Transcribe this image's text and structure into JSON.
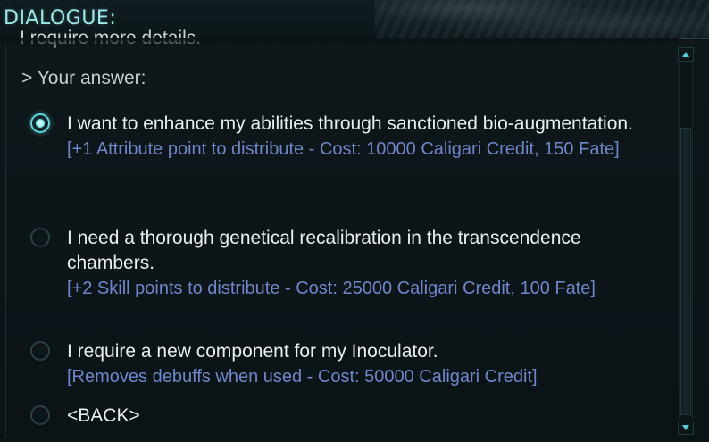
{
  "header": {
    "title": "DIALOGUE:"
  },
  "dialogue": {
    "previous_line": "I require more details.",
    "prompt": "> Your answer:",
    "options": [
      {
        "text": "I want to enhance my abilities through sanctioned bio-augmentation.",
        "detail": "[+1 Attribute point to distribute - Cost: 10000 Caligari Credit, 150 Fate]",
        "selected": true
      },
      {
        "text": "I need a thorough genetical recalibration in the transcendence chambers.",
        "detail": "[+2 Skill points to distribute - Cost: 25000 Caligari Credit, 100 Fate]",
        "selected": false
      },
      {
        "text": "I require a new component for my Inoculator.",
        "detail": "[Removes debuffs when used - Cost: 50000 Caligari Credit]",
        "selected": false
      },
      {
        "text": "<BACK>",
        "detail": "",
        "selected": false
      }
    ]
  },
  "scrollbar": {
    "up_icon": "arrow-up-icon",
    "down_icon": "arrow-down-icon"
  },
  "colors": {
    "title": "#9fe6e6",
    "option_text": "#e9eef0",
    "detail_text": "#6f86c9",
    "accent": "#5fd6dc"
  }
}
